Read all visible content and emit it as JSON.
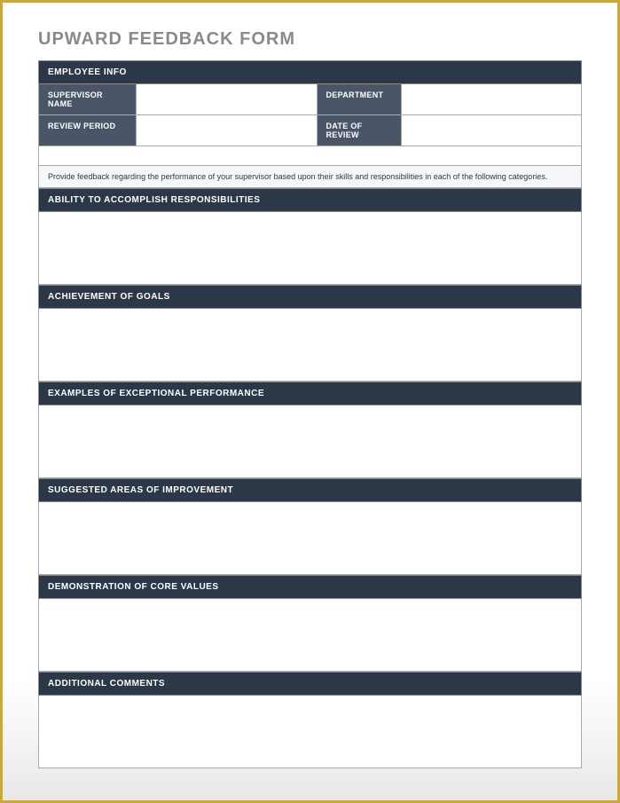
{
  "form": {
    "title": "UPWARD FEEDBACK FORM",
    "employee_info_header": "EMPLOYEE INFO",
    "supervisor_name_label": "SUPERVISOR NAME",
    "supervisor_name_value": "",
    "department_label": "DEPARTMENT",
    "department_value": "",
    "review_period_label": "REVIEW PERIOD",
    "review_period_value": "",
    "date_of_review_label": "DATE OF REVIEW",
    "date_of_review_value": "",
    "instruction": "Provide feedback regarding the performance of your supervisor based upon their skills and responsibilities in each of the following categories.",
    "sections": [
      {
        "header": "ABILITY TO ACCOMPLISH RESPONSIBILITIES",
        "value": ""
      },
      {
        "header": "ACHIEVEMENT OF GOALS",
        "value": ""
      },
      {
        "header": "EXAMPLES OF EXCEPTIONAL PERFORMANCE",
        "value": ""
      },
      {
        "header": "SUGGESTED AREAS OF IMPROVEMENT",
        "value": ""
      },
      {
        "header": "DEMONSTRATION OF CORE VALUES",
        "value": ""
      },
      {
        "header": "ADDITIONAL COMMENTS",
        "value": ""
      }
    ]
  }
}
